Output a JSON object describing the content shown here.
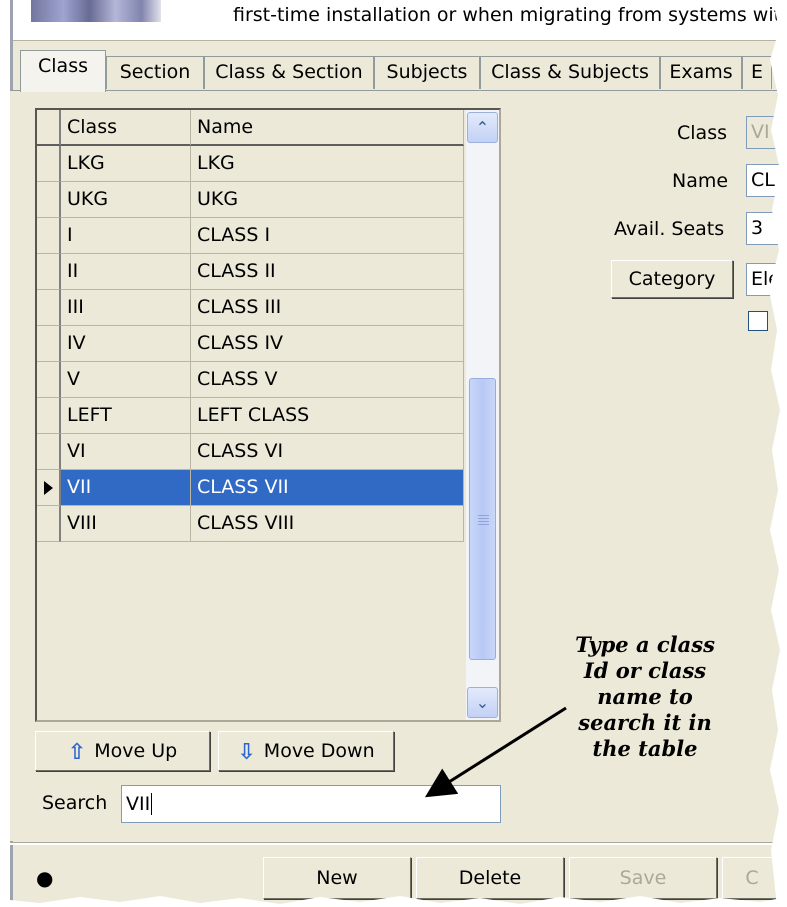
{
  "header": {
    "text": "first-time installation or when migrating from systems with no"
  },
  "tabs": [
    {
      "label": "Class",
      "active": true
    },
    {
      "label": "Section"
    },
    {
      "label": "Class & Section"
    },
    {
      "label": "Subjects"
    },
    {
      "label": "Class & Subjects"
    },
    {
      "label": "Exams"
    },
    {
      "label": "E"
    }
  ],
  "grid": {
    "columns": [
      "Class",
      "Name"
    ],
    "rows": [
      {
        "class": "LKG",
        "name": "LKG"
      },
      {
        "class": "UKG",
        "name": "UKG"
      },
      {
        "class": "I",
        "name": "CLASS I"
      },
      {
        "class": "II",
        "name": "CLASS II"
      },
      {
        "class": "III",
        "name": "CLASS III"
      },
      {
        "class": "IV",
        "name": "CLASS IV"
      },
      {
        "class": "V",
        "name": "CLASS V"
      },
      {
        "class": "LEFT",
        "name": "LEFT CLASS"
      },
      {
        "class": "VI",
        "name": "CLASS VI"
      },
      {
        "class": "VII",
        "name": "CLASS VII",
        "selected": true
      },
      {
        "class": "VIII",
        "name": "CLASS VIII"
      }
    ]
  },
  "buttons": {
    "move_up": "Move Up",
    "move_down": "Move Down",
    "category": "Category",
    "new": "New",
    "delete": "Delete",
    "save": "Save",
    "cut": "C"
  },
  "search": {
    "label": "Search",
    "value": "VII"
  },
  "form": {
    "class_label": "Class",
    "class_value": "VI",
    "name_label": "Name",
    "name_value": "CL",
    "seats_label": "Avail. Seats",
    "seats_value": "3",
    "category_value": "Ele"
  },
  "annotation": {
    "lines": [
      "Type a class",
      "Id or class",
      "name to",
      "search it in",
      "the table"
    ]
  },
  "colors": {
    "selection": "#316ac5",
    "window_bg": "#ece9d8"
  }
}
